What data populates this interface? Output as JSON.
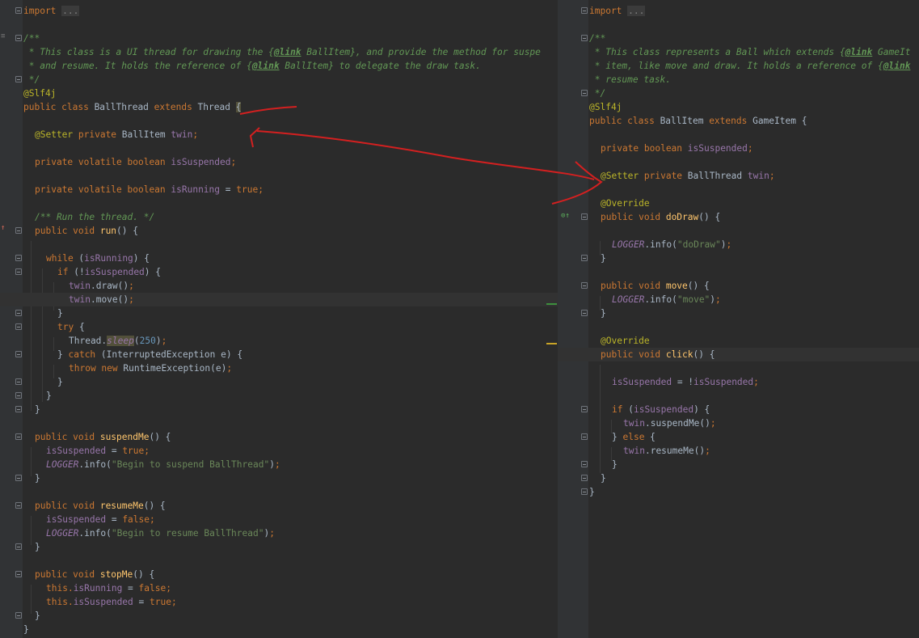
{
  "left_editor": {
    "file": "BallThread",
    "lines": {
      "import": "import",
      "import_folded": "...",
      "doc_open": "/**",
      "doc1_a": " * This class is a UI thread for drawing the ",
      "doc1_tag": "@link",
      "doc1_b": " BallItem}, and provide the method for suspe",
      "doc2_a": " * and resume. It holds the reference of ",
      "doc2_tag": "@link",
      "doc2_b": " BallItem} to delegate the draw task.",
      "doc_close": " */",
      "annotation": "@Slf4j",
      "class_decl_kw": "public class ",
      "class_name": "BallThread ",
      "class_extends": "extends ",
      "class_super": "Thread ",
      "brace_open": "{",
      "field1_ann": "@Setter ",
      "field1_kw": "private ",
      "field1_type": "BallItem ",
      "field1_name": "twin",
      "field2_kw": "private volatile boolean ",
      "field2_name": "isSuspended",
      "field3_kw": "private volatile boolean ",
      "field3_name": "isRunning",
      "field3_eq": " = ",
      "field3_val": "true",
      "run_comment": "/** Run the thread. */",
      "run_kw": "public void ",
      "run_name": "run",
      "while_kw": "while ",
      "while_cond": "isRunning",
      "if_kw": "if ",
      "if_cond": "isSuspended",
      "draw_obj": "twin",
      "draw_call": "draw",
      "move_obj": "twin",
      "move_call": "move",
      "try_kw": "try ",
      "sleep_obj": "Thread.",
      "sleep_call": "sleep",
      "sleep_val": "250",
      "catch_kw": "catch ",
      "catch_type": "InterruptedException e",
      "throw_kw": "throw new ",
      "throw_type": "RuntimeException",
      "throw_arg": "e",
      "suspend_name": "suspendMe",
      "suspend_field": "isSuspended",
      "suspend_val": "true",
      "logger": "LOGGER",
      "info": "info",
      "suspend_msg": "\"Begin to suspend BallThread\"",
      "resume_name": "resumeMe",
      "resume_val": "false",
      "resume_msg": "\"Begin to resume BallThread\"",
      "stop_name": "stopMe",
      "this_kw": "this.",
      "stop_field1": "isRunning",
      "stop_val1": "false",
      "stop_field2": "isSuspended",
      "stop_val2": "true"
    }
  },
  "right_editor": {
    "file": "BallItem",
    "lines": {
      "import": "import",
      "import_folded": "...",
      "doc_open": "/**",
      "doc1_a": " * This class represents a Ball which extends ",
      "doc1_tag": "@link",
      "doc1_b": " GameIt",
      "doc2_a": " * item, like move and draw. It holds a reference of ",
      "doc2_tag": "@link",
      "doc3": " * resume task.",
      "doc_close": " */",
      "annotation": "@Slf4j",
      "class_decl_kw": "public class ",
      "class_name": "BallItem ",
      "class_extends": "extends ",
      "class_super": "GameItem ",
      "brace_open": "{",
      "field1_kw": "private boolean ",
      "field1_name": "isSuspended",
      "field2_ann": "@Setter ",
      "field2_kw": "private ",
      "field2_type": "BallThread ",
      "field2_name": "twin",
      "override": "@Override",
      "draw_kw": "public void ",
      "draw_name": "doDraw",
      "logger": "LOGGER",
      "info": "info",
      "draw_msg": "\"doDraw\"",
      "move_name": "move",
      "move_msg": "\"move\"",
      "click_name": "click",
      "click_field": "isSuspended",
      "click_not": " = !",
      "if_kw": "if ",
      "if_cond": "isSuspended",
      "twin": "twin",
      "suspend_call": "suspendMe",
      "else_kw": "else ",
      "resume_call": "resumeMe"
    }
  },
  "colors": {
    "background": "#2b2b2b",
    "keyword": "#cc7832",
    "field": "#9876aa",
    "string": "#6a8759",
    "comment": "#629755",
    "annotation": "#bbb529",
    "method": "#ffc66d",
    "arrow": "#d42020"
  }
}
